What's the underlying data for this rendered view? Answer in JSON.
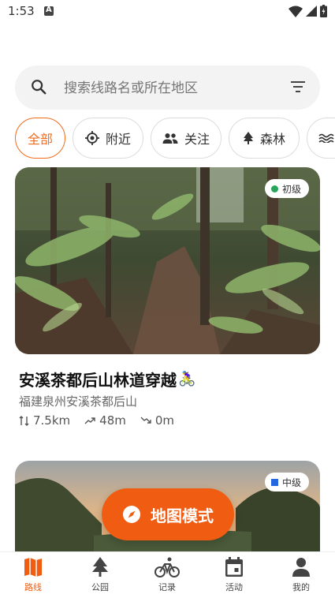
{
  "status_bar": {
    "time": "1:53"
  },
  "search": {
    "placeholder": "搜索线路名或所在地区"
  },
  "filters": [
    {
      "label": "全部",
      "active": true
    },
    {
      "label": "附近",
      "icon": "location-target-icon"
    },
    {
      "label": "关注",
      "icon": "people-icon"
    },
    {
      "label": "森林",
      "icon": "tree-icon"
    }
  ],
  "routes": [
    {
      "difficulty": "初级",
      "difficulty_color": "#26a65b",
      "title": "安溪茶都后山林道穿越",
      "title_emoji": "🚴‍♀️",
      "location": "福建泉州安溪茶都后山",
      "distance": "7.5km",
      "elevation_gain": "48m",
      "elevation_loss": "0m"
    },
    {
      "difficulty": "中级",
      "difficulty_color": "#2468e0"
    }
  ],
  "fab": {
    "label": "地图模式",
    "icon": "compass-icon"
  },
  "bottom_nav": [
    {
      "label": "路线",
      "icon": "map-icon",
      "active": true
    },
    {
      "label": "公园",
      "icon": "tree-icon"
    },
    {
      "label": "记录",
      "icon": "bicycle-icon"
    },
    {
      "label": "活动",
      "icon": "calendar-icon"
    },
    {
      "label": "我的",
      "icon": "person-icon"
    }
  ],
  "colors": {
    "accent": "#f05d12",
    "chip_active": "#f26b1d"
  }
}
